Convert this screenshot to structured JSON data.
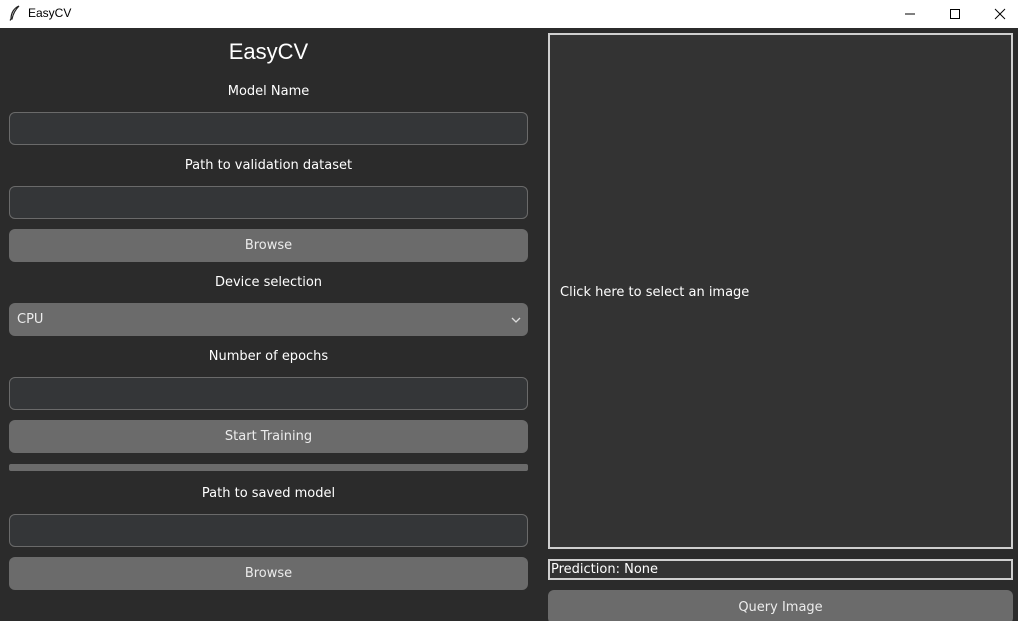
{
  "window": {
    "title": "EasyCV",
    "icon": "feather-icon",
    "controls": [
      "minimize-icon",
      "maximize-icon",
      "close-icon"
    ]
  },
  "left_panel": {
    "heading": "EasyCV",
    "model_name_label": "Model Name",
    "model_name_value": "",
    "validation_label": "Path to validation dataset",
    "validation_value": "",
    "browse_label": "Browse",
    "device_label": "Device selection",
    "device_selected": "CPU",
    "epochs_label": "Number of epochs",
    "epochs_value": "",
    "start_training_label": "Start Training",
    "progress": 0,
    "saved_model_label": "Path to saved model",
    "saved_model_value": "",
    "browse2_label": "Browse"
  },
  "right_panel": {
    "image_hint": "Click here to select an image",
    "prediction_text": "Prediction: None",
    "query_label": "Query Image"
  },
  "colors": {
    "background": "#2b2b2b",
    "button": "#6b6b6b",
    "panel_border": "#cfcfcf",
    "titlebar": "#ffffff"
  }
}
